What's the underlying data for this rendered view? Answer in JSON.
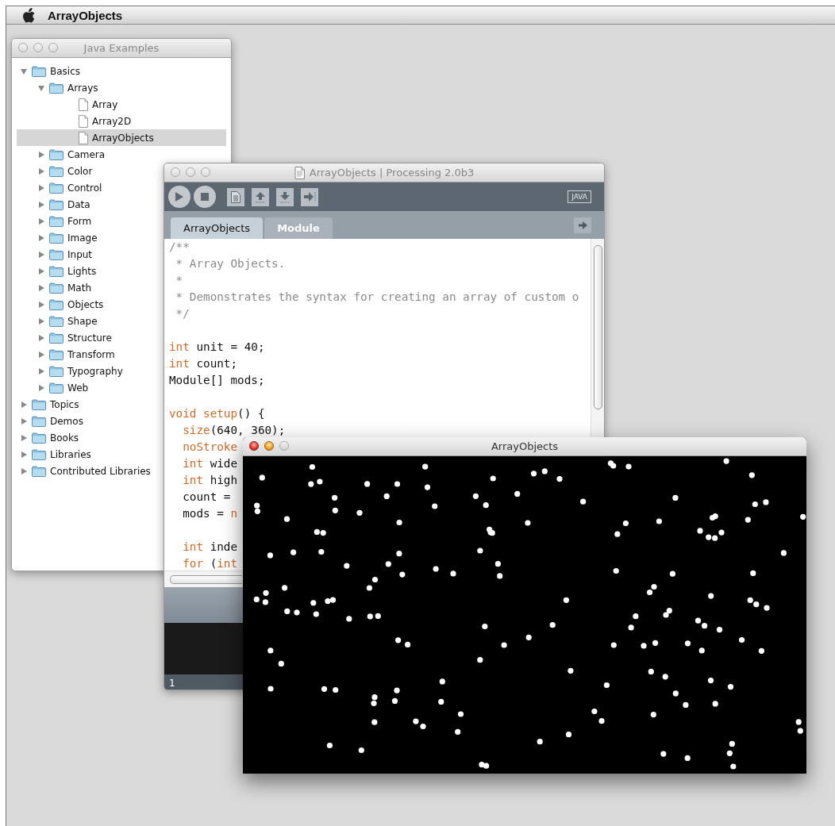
{
  "menu_bar": {
    "app_name": "ArrayObjects"
  },
  "examples_window": {
    "title": "Java Examples",
    "active": false,
    "tree": [
      {
        "label": "Basics",
        "kind": "folder",
        "expanded": true,
        "selected": false,
        "children": [
          {
            "label": "Arrays",
            "kind": "folder",
            "expanded": true,
            "selected": false,
            "children": [
              {
                "label": "Array",
                "kind": "file",
                "selected": false
              },
              {
                "label": "Array2D",
                "kind": "file",
                "selected": false
              },
              {
                "label": "ArrayObjects",
                "kind": "file",
                "selected": true
              }
            ]
          },
          {
            "label": "Camera",
            "kind": "folder",
            "expanded": false,
            "selected": false
          },
          {
            "label": "Color",
            "kind": "folder",
            "expanded": false,
            "selected": false
          },
          {
            "label": "Control",
            "kind": "folder",
            "expanded": false,
            "selected": false
          },
          {
            "label": "Data",
            "kind": "folder",
            "expanded": false,
            "selected": false
          },
          {
            "label": "Form",
            "kind": "folder",
            "expanded": false,
            "selected": false
          },
          {
            "label": "Image",
            "kind": "folder",
            "expanded": false,
            "selected": false
          },
          {
            "label": "Input",
            "kind": "folder",
            "expanded": false,
            "selected": false
          },
          {
            "label": "Lights",
            "kind": "folder",
            "expanded": false,
            "selected": false
          },
          {
            "label": "Math",
            "kind": "folder",
            "expanded": false,
            "selected": false
          },
          {
            "label": "Objects",
            "kind": "folder",
            "expanded": false,
            "selected": false
          },
          {
            "label": "Shape",
            "kind": "folder",
            "expanded": false,
            "selected": false
          },
          {
            "label": "Structure",
            "kind": "folder",
            "expanded": false,
            "selected": false
          },
          {
            "label": "Transform",
            "kind": "folder",
            "expanded": false,
            "selected": false
          },
          {
            "label": "Typography",
            "kind": "folder",
            "expanded": false,
            "selected": false
          },
          {
            "label": "Web",
            "kind": "folder",
            "expanded": false,
            "selected": false
          }
        ]
      },
      {
        "label": "Topics",
        "kind": "folder",
        "expanded": false,
        "selected": false
      },
      {
        "label": "Demos",
        "kind": "folder",
        "expanded": false,
        "selected": false
      },
      {
        "label": "Books",
        "kind": "folder",
        "expanded": false,
        "selected": false
      },
      {
        "label": "Libraries",
        "kind": "folder",
        "expanded": false,
        "selected": false
      },
      {
        "label": "Contributed Libraries",
        "kind": "folder",
        "expanded": false,
        "selected": false
      }
    ]
  },
  "editor_window": {
    "title": "ArrayObjects | Processing 2.0b3",
    "active": false,
    "mode": "JAVA",
    "tabs": [
      {
        "label": "ArrayObjects",
        "selected": true
      },
      {
        "label": "Module",
        "selected": false
      }
    ],
    "code_blocks": [
      [
        [
          {
            "kind": "comment",
            "text": "/**"
          }
        ],
        [
          {
            "kind": "comment",
            "text": " * Array Objects."
          }
        ],
        [
          {
            "kind": "comment",
            "text": " *"
          }
        ],
        [
          {
            "kind": "comment",
            "text": " * Demonstrates the syntax for creating an array of custom o"
          }
        ],
        [
          {
            "kind": "comment",
            "text": " */"
          }
        ]
      ],
      [
        [
          {
            "kind": "keyword",
            "text": "int"
          },
          {
            "kind": "plain",
            "text": " unit = 40;"
          }
        ],
        [
          {
            "kind": "keyword",
            "text": "int"
          },
          {
            "kind": "plain",
            "text": " count;"
          }
        ],
        [
          {
            "kind": "plain",
            "text": "Module[] mods;"
          }
        ]
      ],
      [
        [
          {
            "kind": "keyword",
            "text": "void"
          },
          {
            "kind": "keyword",
            "text": " setup"
          },
          {
            "kind": "plain",
            "text": "() {"
          }
        ],
        [
          {
            "kind": "keyword",
            "text": "  size"
          },
          {
            "kind": "plain",
            "text": "(640, 360);"
          }
        ],
        [
          {
            "kind": "keyword",
            "text": "  noStroke"
          }
        ],
        [
          {
            "kind": "keyword",
            "text": "  int"
          },
          {
            "kind": "plain",
            "text": " wide"
          }
        ],
        [
          {
            "kind": "keyword",
            "text": "  int"
          },
          {
            "kind": "plain",
            "text": " high"
          }
        ],
        [
          {
            "kind": "plain",
            "text": "  count ="
          }
        ],
        [
          {
            "kind": "plain",
            "text": "  mods = "
          },
          {
            "kind": "keyword",
            "text": "n"
          }
        ]
      ],
      [
        [
          {
            "kind": "keyword",
            "text": "  int"
          },
          {
            "kind": "plain",
            "text": " inde"
          }
        ],
        [
          {
            "kind": "keyword",
            "text": "  for"
          },
          {
            "kind": "plain",
            "text": " ("
          },
          {
            "kind": "keyword",
            "text": "int"
          }
        ]
      ]
    ],
    "line_number": "1"
  },
  "sketch_window": {
    "title": "ArrayObjects",
    "active": true
  }
}
